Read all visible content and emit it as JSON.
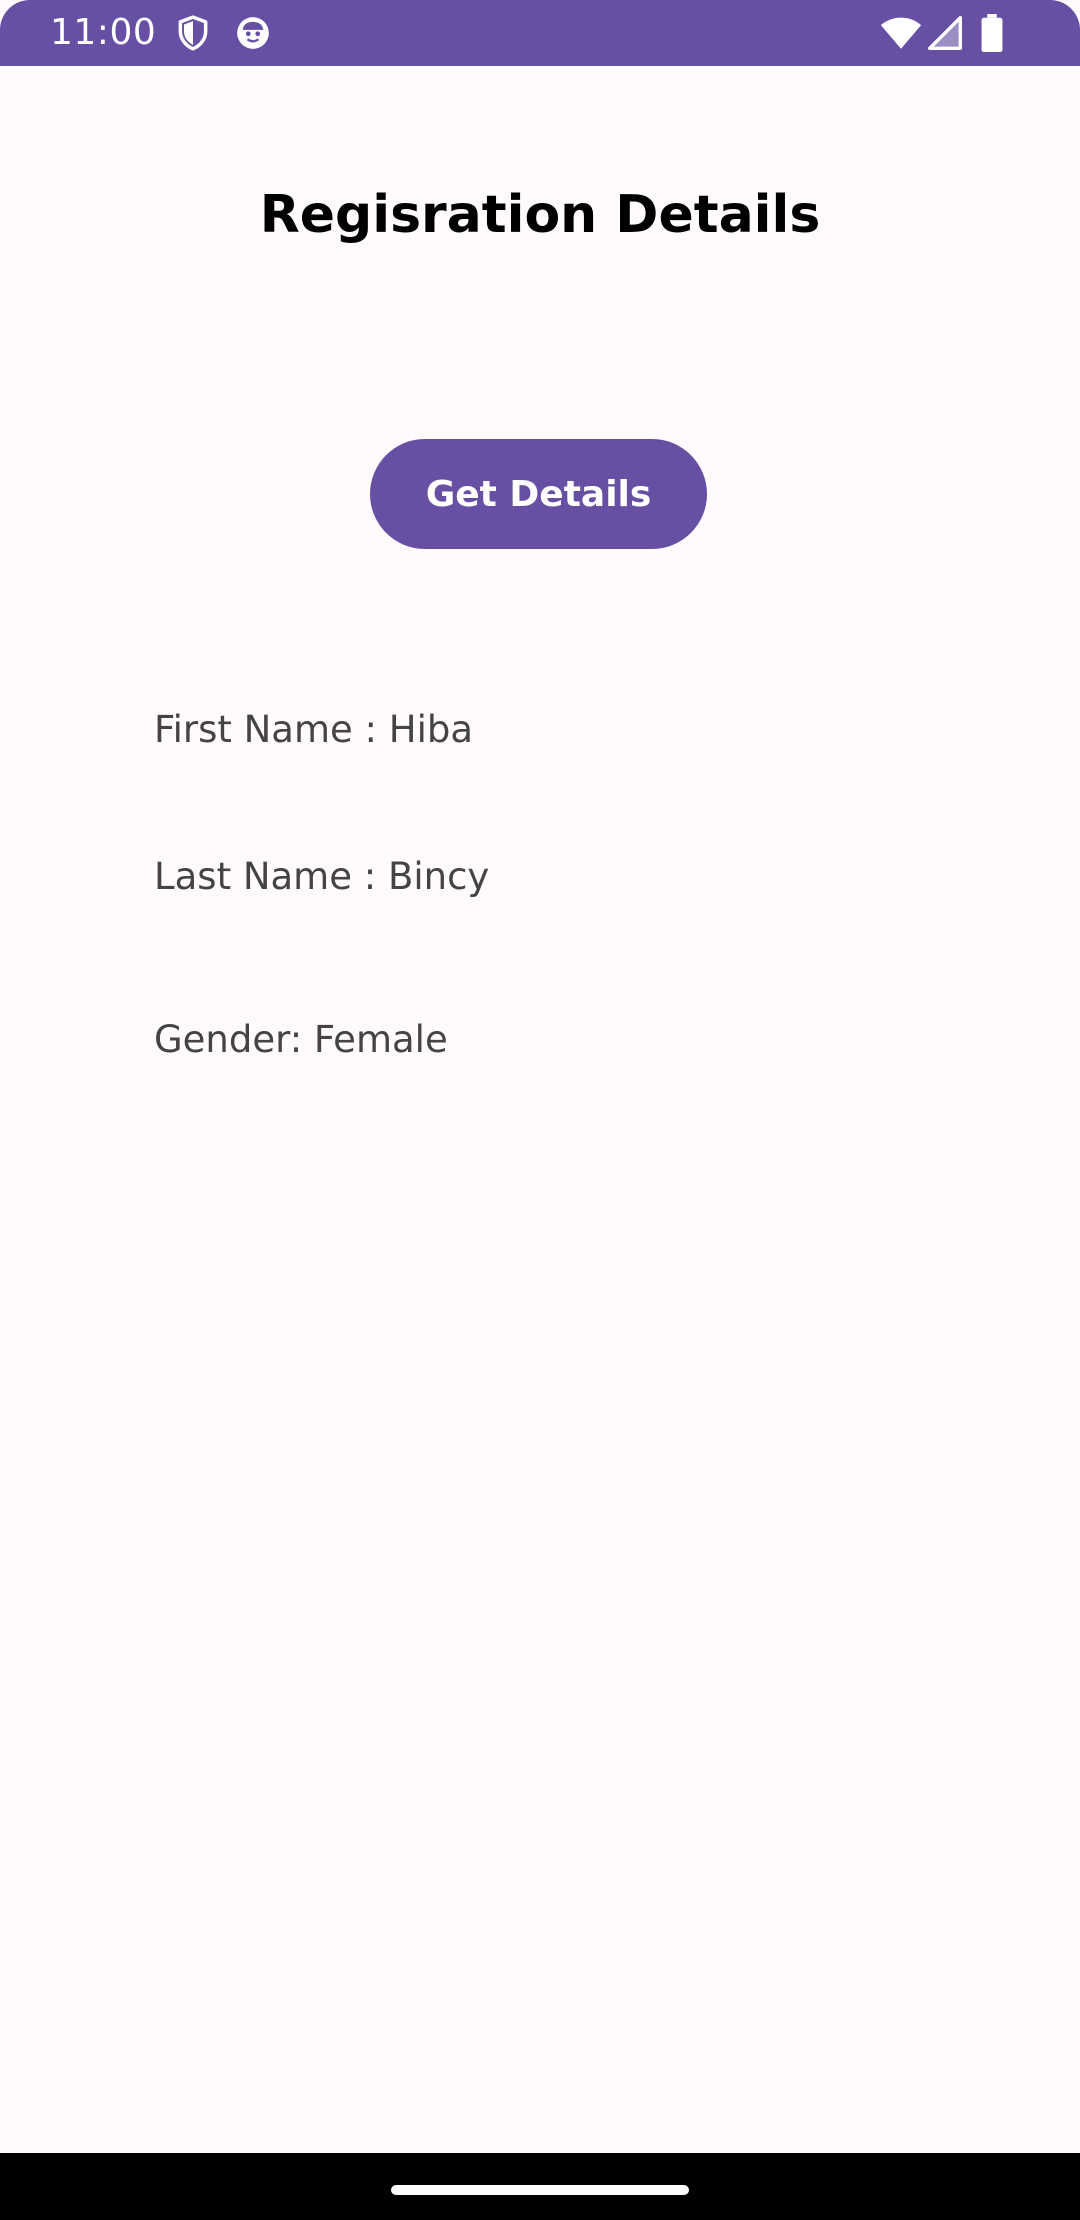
{
  "status_bar": {
    "time": "11:00",
    "icons": [
      "shield-icon",
      "face-icon",
      "wifi-icon",
      "signal-icon",
      "battery-icon"
    ],
    "color": "#6750A4"
  },
  "page": {
    "title": "Regisration Details",
    "button_label": "Get Details",
    "accent_color": "#6750A4",
    "background_color": "#FFFAFE"
  },
  "details": {
    "first_name": "First Name : Hiba",
    "last_name": "Last Name : Bincy",
    "gender": "Gender: Female"
  }
}
